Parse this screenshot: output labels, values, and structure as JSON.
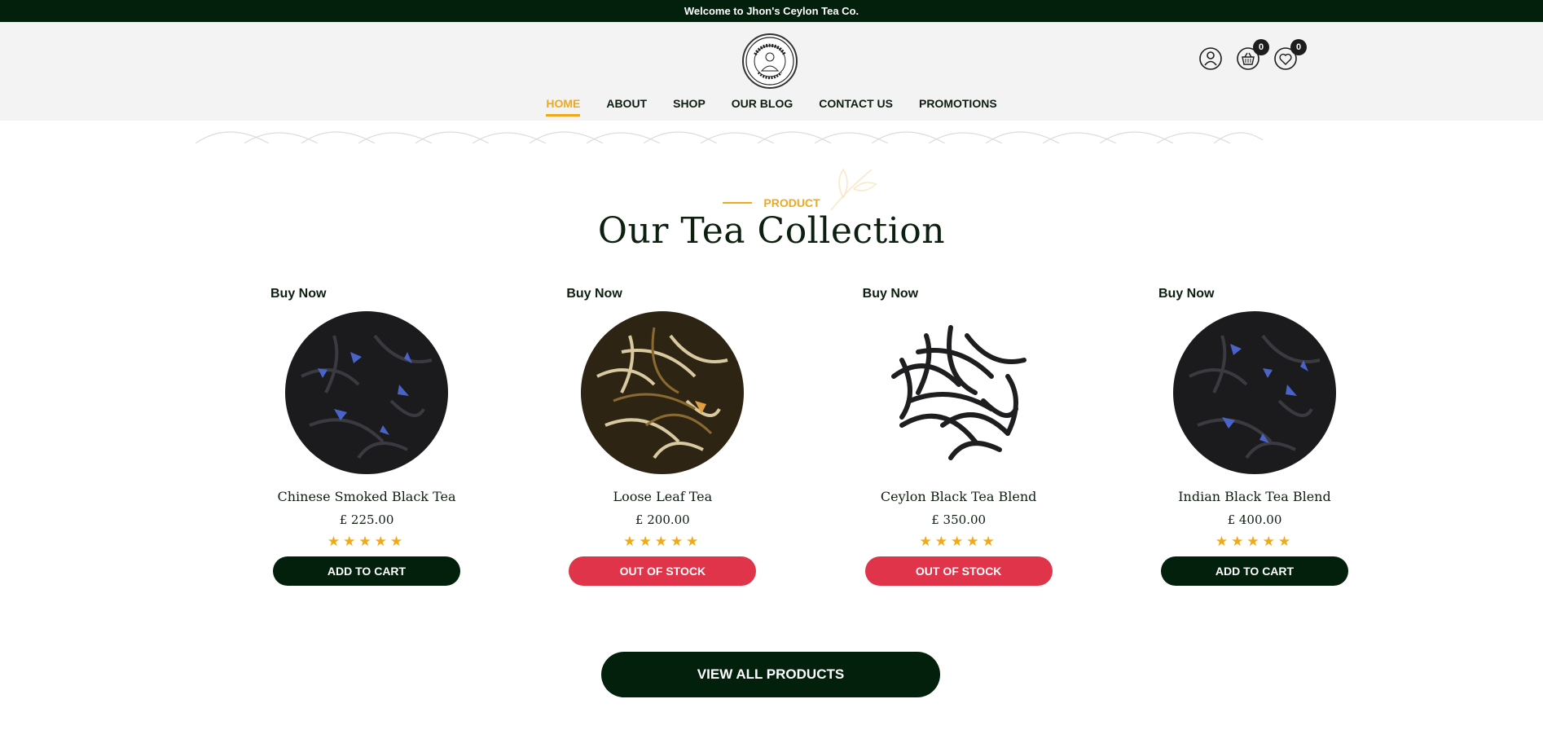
{
  "topbar": {
    "welcome": "Welcome to Jhon's Ceylon Tea Co."
  },
  "header": {
    "logo_alt": "JOHN'S CEYLON TEA CO. PREMIUM TEA",
    "cart_count": "0",
    "wishlist_count": "0",
    "nav": [
      {
        "label": "HOME",
        "active": true
      },
      {
        "label": "ABOUT"
      },
      {
        "label": "SHOP"
      },
      {
        "label": "OUR BLOG"
      },
      {
        "label": "CONTACT US"
      },
      {
        "label": "PROMOTIONS"
      }
    ]
  },
  "section": {
    "eyebrow": "PRODUCT",
    "title": "Our Tea Collection"
  },
  "products": [
    {
      "buy_now": "Buy Now",
      "name": "Chinese Smoked Black Tea",
      "price": "£ 225.00",
      "rating": 5,
      "button": "ADD TO CART",
      "status": "in-stock"
    },
    {
      "buy_now": "Buy Now",
      "name": "Loose Leaf Tea",
      "price": "£ 200.00",
      "rating": 5,
      "button": "OUT OF STOCK",
      "status": "out-of-stock"
    },
    {
      "buy_now": "Buy Now",
      "name": "Ceylon Black Tea Blend",
      "price": "£ 350.00",
      "rating": 5,
      "button": "OUT OF STOCK",
      "status": "out-of-stock"
    },
    {
      "buy_now": "Buy Now",
      "name": "Indian Black Tea Blend",
      "price": "£ 400.00",
      "rating": 5,
      "button": "ADD TO CART",
      "status": "in-stock"
    }
  ],
  "view_all": "VIEW ALL PRODUCTS",
  "colors": {
    "dark_green": "#02200c",
    "accent": "#f0a91a",
    "out_of_stock": "#e0344b"
  }
}
